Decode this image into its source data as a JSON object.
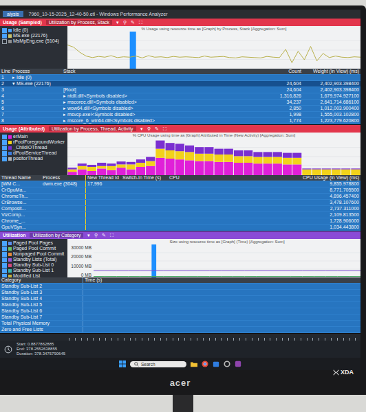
{
  "window": {
    "tab": "alysis",
    "title": "7960_10-15-2025_12-40-50.etl - Windows Performance Analyzer"
  },
  "panels": [
    {
      "kind": "line",
      "color": "#e2364c",
      "title": "Usage (Sampled)",
      "view": "Utilization by Process, Stack",
      "tools": [
        "▾",
        "⚲",
        "✎",
        "⛶"
      ],
      "legend": [
        {
          "label": "Idle (0)",
          "checked": true,
          "color": "#4aa3ff"
        },
        {
          "label": "MS.exe (22176)",
          "checked": true,
          "color": "#c9c36a"
        },
        {
          "label": "MsMpEng.exe (5104)",
          "checked": false,
          "color": "#8f8f8f"
        }
      ],
      "chart": {
        "caption": "% Usage using resource time as [Graph] by Process, Stack [Aggregation: Sum]",
        "y_max": 100,
        "ticks": [],
        "highlight": {
          "from": 10,
          "to": 11
        },
        "series": [
          {
            "name": "MS.exe (22176)",
            "color": "#b8b04a",
            "values": [
              64,
              58,
              44,
              34,
              30,
              33,
              31,
              35,
              30,
              32,
              31,
              34,
              29,
              35,
              31,
              32,
              30,
              33,
              31,
              32,
              31,
              30,
              34,
              31,
              32,
              33,
              30,
              29,
              32,
              31,
              30,
              29,
              33,
              31,
              30,
              52,
              16,
              47,
              24,
              60,
              21,
              41,
              30,
              34,
              31,
              30,
              32,
              31
            ]
          }
        ]
      },
      "table": {
        "columns": [
          "Line",
          "Process",
          "Stack",
          "Count",
          "Weight (In View) (ms)"
        ],
        "rows": [
          {
            "cells": [
              "1",
              "▸ Idle (0)",
              "",
              "",
              ""
            ],
            "selected": false
          },
          {
            "cells": [
              "2",
              "▾ MS.exe (22176)",
              "",
              "24,604",
              "2,402,903.398400"
            ],
            "selected": true
          },
          {
            "cells": [
              "3",
              "",
              "[Root]",
              "24,604",
              "2,402,903.398400"
            ],
            "selected": false
          },
          {
            "cells": [
              "4",
              "",
              "▸ ntdll.dll!<Symbols disabled>",
              "1,316,826",
              "1,679,974.927100"
            ],
            "selected": false
          },
          {
            "cells": [
              "5",
              "",
              "▸ mscoree.dll!<Symbols disabled>",
              "34,237",
              "2,641,714.686100"
            ],
            "selected": false
          },
          {
            "cells": [
              "6",
              "",
              "▸ wow64.dll!<Symbols disabled>",
              "2,850",
              "1,012,003.900400"
            ],
            "selected": false
          },
          {
            "cells": [
              "7",
              "",
              "▸ msvcp.exe!<Symbols disabled>",
              "1,998",
              "1,555,003.102800"
            ],
            "selected": false
          },
          {
            "cells": [
              "8",
              "",
              "▸ mscore_6_win64.dll!<Symbols disabled>",
              "1,774",
              "1,223,779.620800"
            ],
            "selected": false
          }
        ]
      }
    },
    {
      "kind": "bar",
      "color": "#e2364c",
      "title": "Usage (Attributed)",
      "view": "Utilization by Process, Thread, Activity",
      "tools": [
        "▾",
        "⚲",
        "✎",
        "⛶"
      ],
      "legend": [
        {
          "label": "erMain",
          "checked": true,
          "color": "#e020d8"
        },
        {
          "label": "rPoolForegroundWorker",
          "checked": true,
          "color": "#f2d21b"
        },
        {
          "label": "_ChildIOThread",
          "checked": true,
          "color": "#7a2fd0"
        },
        {
          "label": "dPoolServiceThread",
          "checked": true,
          "color": "#3a7be0"
        },
        {
          "label": "positorThread",
          "checked": true,
          "color": "#b0b0b0"
        }
      ],
      "chart": {
        "caption": "% CPU Usage using time as [Graph] Attributed in Time (New Activity) [Aggregation: Sum]",
        "y_max": 90,
        "ticks": [],
        "series": [
          {
            "name": "CrRendererMain",
            "color": "#e020d8",
            "values": [
              8,
              14,
              10,
              16,
              12,
              18,
              14,
              20,
              22,
              42,
              40,
              38,
              36,
              34,
              34,
              32,
              32,
              30,
              30,
              28,
              28,
              28,
              26,
              26,
              0,
              0,
              0,
              0,
              0,
              0
            ]
          },
          {
            "name": "ThreadPoolForegroundWorker",
            "color": "#f2d21b",
            "values": [
              6,
              8,
              10,
              6,
              10,
              8,
              12,
              10,
              12,
              22,
              20,
              20,
              20,
              18,
              18,
              18,
              18,
              16,
              16,
              16,
              16,
              16,
              16,
              16,
              14,
              14,
              14,
              14,
              14,
              14
            ]
          },
          {
            "name": "Chrome_ChildIOThread",
            "color": "#7a2fd0",
            "values": [
              4,
              6,
              5,
              8,
              6,
              7,
              6,
              8,
              10,
              20,
              18,
              18,
              16,
              16,
              16,
              14,
              14,
              14,
              14,
              12,
              12,
              12,
              12,
              12,
              2,
              2,
              2,
              2,
              2,
              2
            ]
          }
        ]
      },
      "table": {
        "columns": [
          "Thread Name",
          "Process",
          "New Thread Id",
          "Switch-In Time (s)",
          "CPU",
          "CPU Usage (in View) (ms)"
        ],
        "rows": [
          {
            "cells": [
              "[WM C...",
              "dwm.exe (3048)",
              "17,996",
              "",
              "",
              "9,855.978800"
            ],
            "selected": false
          },
          {
            "cells": [
              "CrGpuMa...",
              "",
              "",
              "",
              "",
              "8,771.705500"
            ],
            "selected": false
          },
          {
            "cells": [
              "ChromeTh...",
              "",
              "",
              "",
              "",
              "4,896.457400"
            ],
            "selected": false
          },
          {
            "cells": [
              "CrBrowse...",
              "",
              "",
              "",
              "",
              "3,478.107600"
            ],
            "selected": false
          },
          {
            "cells": [
              "Composit...",
              "",
              "",
              "",
              "",
              "2,737.311000"
            ],
            "selected": false
          },
          {
            "cells": [
              "VizComp...",
              "",
              "",
              "",
              "",
              "2,109.813500"
            ],
            "selected": false
          },
          {
            "cells": [
              "Chrome_...",
              "",
              "",
              "",
              "",
              "1,728.906000"
            ],
            "selected": false
          },
          {
            "cells": [
              "GpuVSyn...",
              "",
              "",
              "",
              "",
              "1,034.443800"
            ],
            "selected": false
          }
        ]
      }
    },
    {
      "kind": "line",
      "color": "#8a4bd6",
      "title": "Utilization",
      "view": "Utilization by Category",
      "tools": [
        "▾",
        "⚲",
        "✎",
        "⛶"
      ],
      "legend": [
        {
          "label": "Paged Pool Pages",
          "checked": true,
          "color": "#5b8def"
        },
        {
          "label": "Paged Pool Commit",
          "checked": true,
          "color": "#6cc36a"
        },
        {
          "label": "Nonpaged Pool Commit",
          "checked": true,
          "color": "#e58a3a"
        },
        {
          "label": "Standby Lists (Total)",
          "checked": true,
          "color": "#9b59d6"
        },
        {
          "label": "Standby Sub-List 0",
          "checked": true,
          "color": "#d64a7a"
        },
        {
          "label": "Standby Sub-List 1",
          "checked": true,
          "color": "#3ab5b0"
        },
        {
          "label": "Modified List",
          "checked": true,
          "color": "#c9b43a"
        }
      ],
      "chart": {
        "caption": "Size using resource time as [Graph] (Time) [Aggregation: Sum]",
        "y_max": 30000,
        "ticks": [
          "30000 MB",
          "20000 MB",
          "10000 MB",
          "0 MB"
        ],
        "highlight": {
          "from": 5,
          "to": 5.4
        },
        "series": [
          {
            "name": "Standby Lists (Total)",
            "color": "#7b4bd0",
            "values": [
              6200,
              6200,
              6150,
              6180,
              6200,
              6220,
              6210,
              6200,
              6190,
              6200,
              6210,
              6200,
              6200,
              6190,
              6200,
              6210,
              6200,
              6200,
              6190,
              6200,
              6200,
              6210,
              6200,
              6200
            ]
          },
          {
            "name": "Paged Pool Commit",
            "color": "#3fa55a",
            "values": [
              900,
              950,
              920,
              940,
              960,
              930,
              950,
              940,
              960,
              950,
              940,
              950,
              960,
              950,
              940,
              950,
              960,
              950,
              940,
              950,
              960,
              950,
              940,
              950
            ]
          }
        ]
      },
      "table": {
        "columns": [
          "Category",
          "Time (s)"
        ],
        "rows": [
          {
            "cells": [
              "Standby Sub-List 2",
              ""
            ],
            "selected": false
          },
          {
            "cells": [
              "Standby Sub-List 3",
              ""
            ],
            "selected": false
          },
          {
            "cells": [
              "Standby Sub-List 4",
              ""
            ],
            "selected": false
          },
          {
            "cells": [
              "Standby Sub-List 5",
              ""
            ],
            "selected": false
          },
          {
            "cells": [
              "Standby Sub-List 6",
              ""
            ],
            "selected": false
          },
          {
            "cells": [
              "Standby Sub-List 7",
              ""
            ],
            "selected": false
          },
          {
            "cells": [
              "Total Physical Memory",
              ""
            ],
            "selected": false
          },
          {
            "cells": [
              "Zero and Free Lists",
              ""
            ],
            "selected": false
          }
        ]
      }
    }
  ],
  "status": {
    "start": "Start: 0.8877862885",
    "end": "End: 378.2552638855",
    "duration": "Duration: 378.3475790645"
  },
  "taskbar": {
    "search": {
      "placeholder": "Search"
    }
  },
  "monitor": {
    "brand": "acer"
  },
  "watermark": {
    "text": "XDA"
  }
}
